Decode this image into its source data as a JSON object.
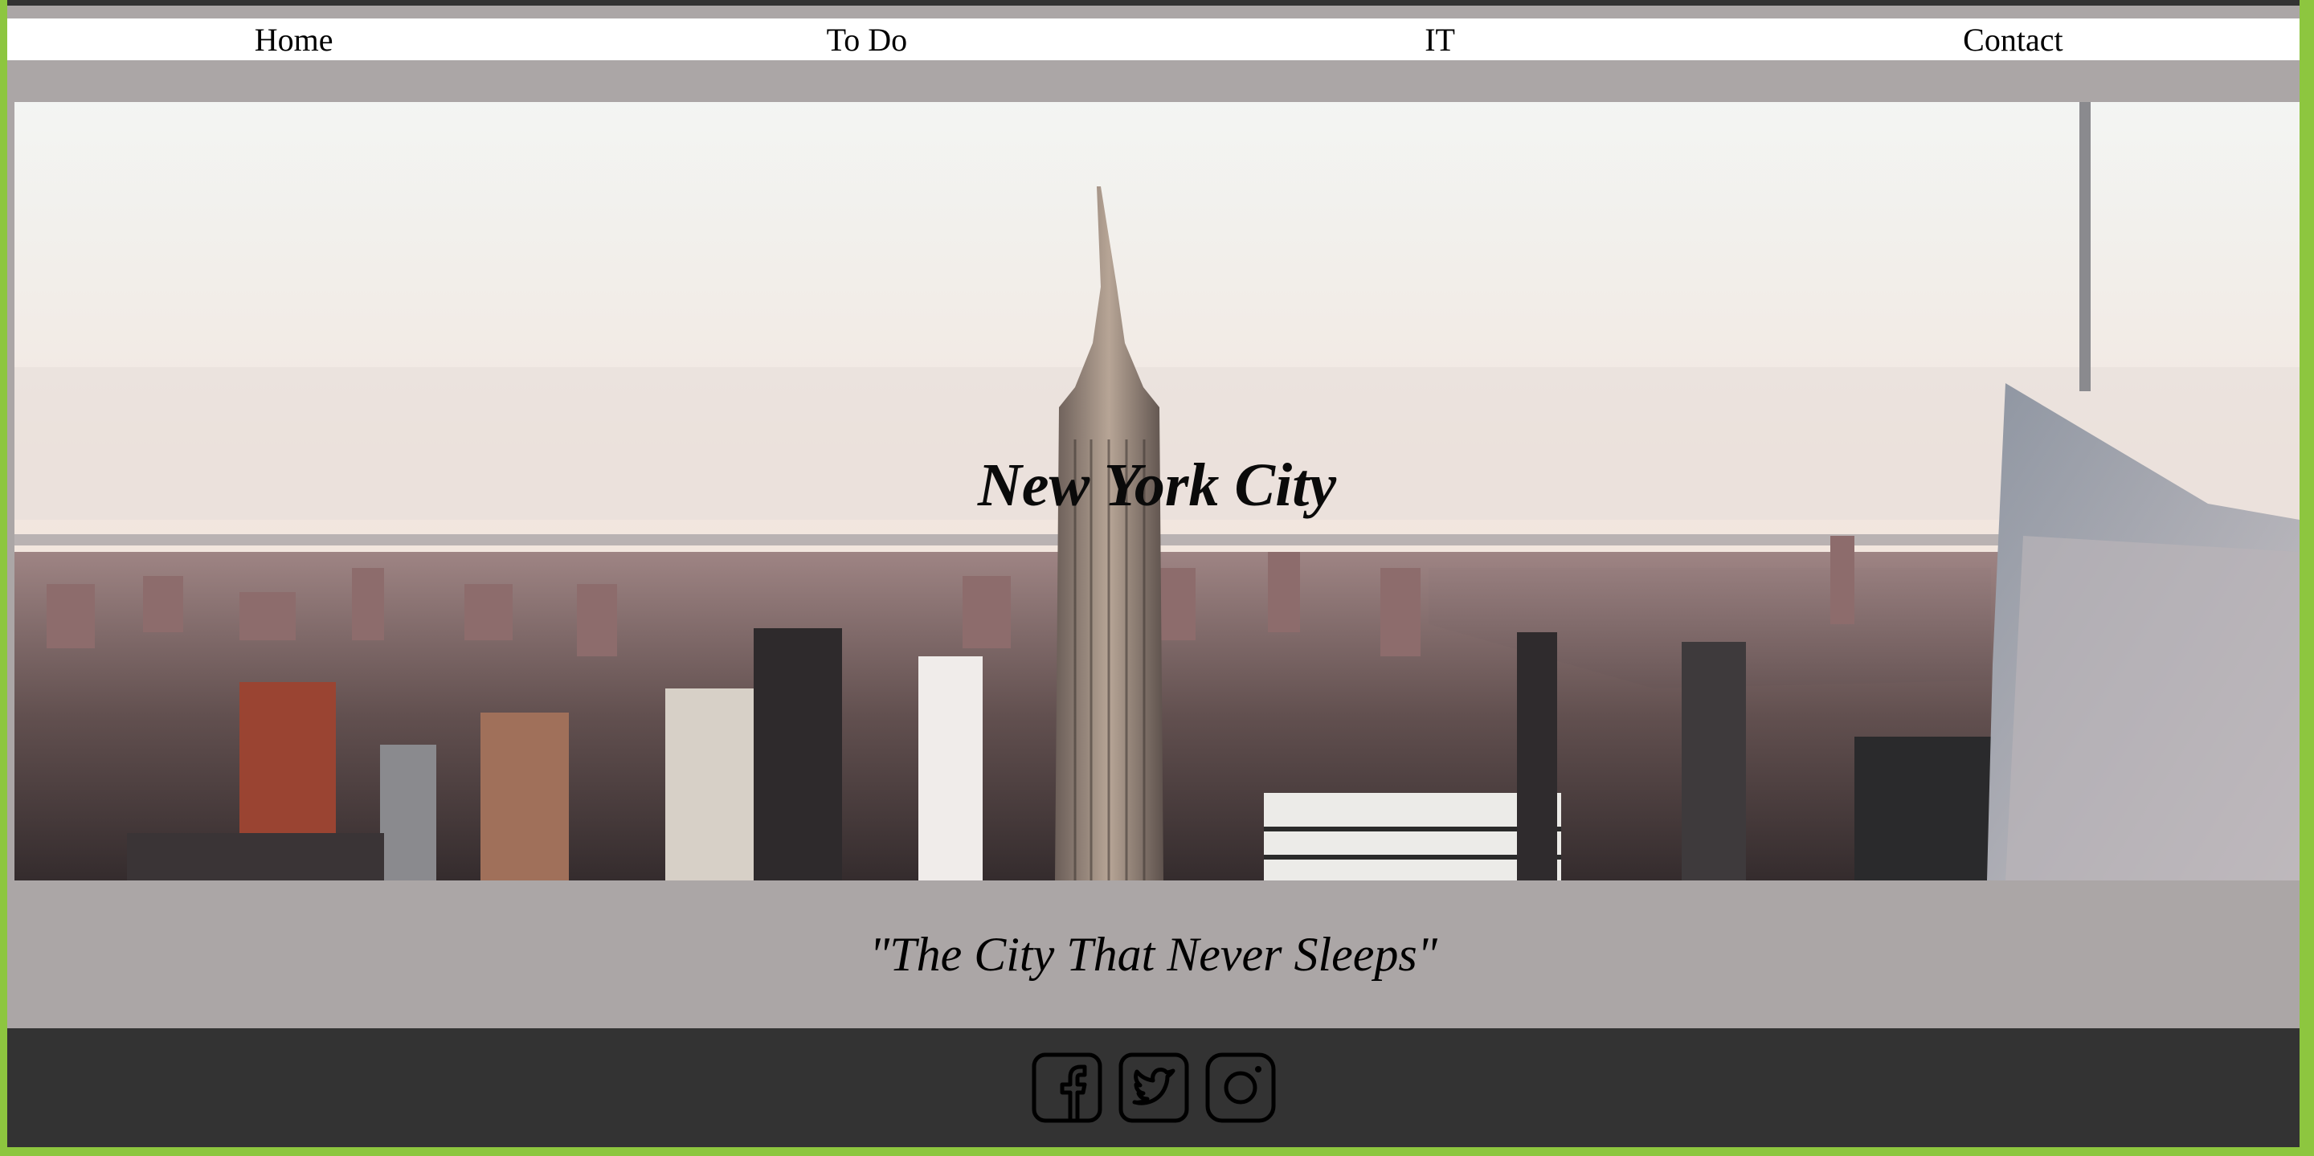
{
  "nav": {
    "items": [
      {
        "label": "Home"
      },
      {
        "label": "To Do"
      },
      {
        "label": "IT"
      },
      {
        "label": "Contact"
      }
    ]
  },
  "hero": {
    "title": "New York City"
  },
  "tagline": "\"The City That Never Sleeps\"",
  "footer": {
    "social": [
      {
        "icon": "facebook-icon"
      },
      {
        "icon": "twitter-icon"
      },
      {
        "icon": "instagram-icon"
      }
    ]
  },
  "colors": {
    "page_border": "#8dc63f",
    "content_bg": "#aba6a6",
    "footer_bg": "#333333",
    "nav_bg": "#ffffff"
  }
}
